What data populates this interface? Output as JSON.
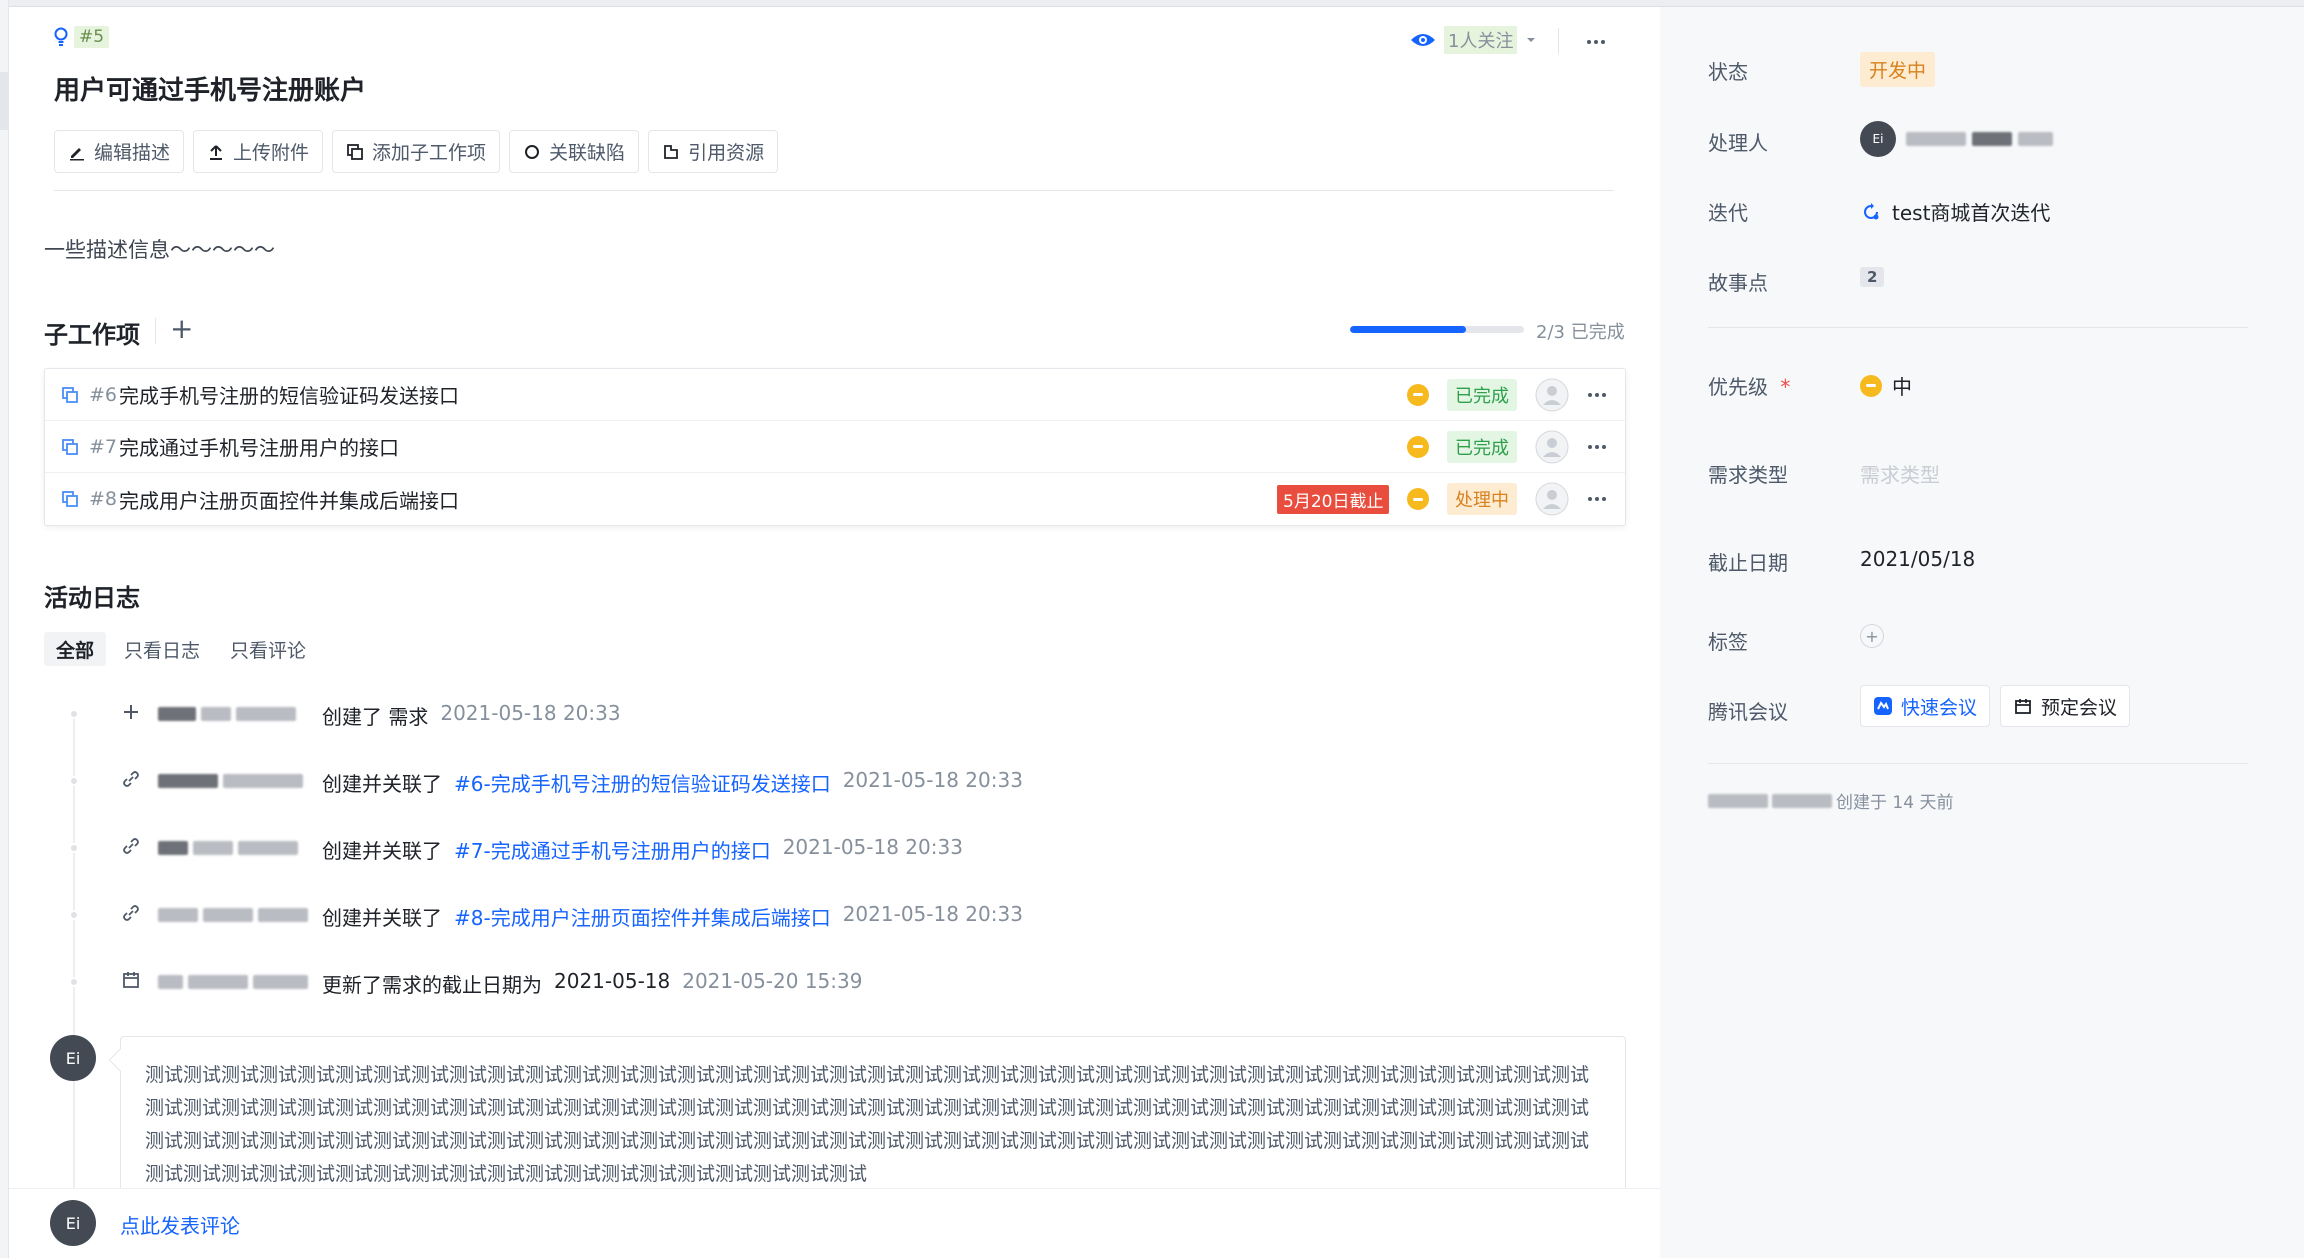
{
  "header": {
    "item_id": "#5",
    "title": "用户可通过手机号注册账户",
    "watch_label": "1人关注"
  },
  "toolbar": {
    "edit_desc": "编辑描述",
    "upload": "上传附件",
    "add_sub": "添加子工作项",
    "link_bug": "关联缺陷",
    "cite_resource": "引用资源"
  },
  "description": "一些描述信息～～～～～",
  "sub_items": {
    "title": "子工作项",
    "progress_text": "2/3 已完成",
    "progress_fraction": 0.6667,
    "rows": [
      {
        "num": "#6",
        "name": "完成手机号注册的短信验证码发送接口",
        "deadline": "",
        "status": "已完成",
        "status_kind": "done"
      },
      {
        "num": "#7",
        "name": "完成通过手机号注册用户的接口",
        "deadline": "",
        "status": "已完成",
        "status_kind": "done"
      },
      {
        "num": "#8",
        "name": "完成用户注册页面控件并集成后端接口",
        "deadline": "5月20日截止",
        "status": "处理中",
        "status_kind": "doing"
      }
    ]
  },
  "activity": {
    "title": "活动日志",
    "tabs": [
      "全部",
      "只看日志",
      "只看评论"
    ],
    "logs": [
      {
        "icon": "plus-icon",
        "action": "创建了 需求",
        "link": "",
        "extra": "",
        "time": "2021-05-18 20:33"
      },
      {
        "icon": "link-icon",
        "action": "创建并关联了",
        "link": "#6-完成手机号注册的短信验证码发送接口",
        "extra": "",
        "time": "2021-05-18 20:33"
      },
      {
        "icon": "link-icon",
        "action": "创建并关联了",
        "link": "#7-完成通过手机号注册用户的接口",
        "extra": "",
        "time": "2021-05-18 20:33"
      },
      {
        "icon": "link-icon",
        "action": "创建并关联了",
        "link": "#8-完成用户注册页面控件并集成后端接口",
        "extra": "",
        "time": "2021-05-18 20:33"
      },
      {
        "icon": "calendar-icon",
        "action": "更新了需求的截止日期为",
        "link": "",
        "extra": "2021-05-18",
        "time": "2021-05-20 15:39"
      }
    ],
    "comment_avatar": "Ei",
    "comment_text": "测试测试测试测试测试测试测试测试测试测试测试测试测试测试测试测试测试测试测试测试测试测试测试测试测试测试测试测试测试测试测试测试测试测试测试测试测试测试测试测试测试测试测试测试测试测试测试测试测试测试测试测试测试测试测试测试测试测试测试测试测试测试测试测试测试测试测试测试测试测试测试测试测试测试测试测试测试测试测试测试测试测试测试测试测试测试测试测试测试测试测试测试测试测试测试测试测试测试测试测试测试测试测试测试测试测试测试测试测试测试测试测试测试测试测试测试测试测试测试测试测试测试测试测试测试测试测试测试测试测试测试测试测试"
  },
  "footer": {
    "avatar": "Ei",
    "comment_prompt": "点此发表评论"
  },
  "side": {
    "status_label": "状态",
    "status_value": "开发中",
    "assignee_label": "处理人",
    "assignee_avatar": "Ei",
    "iteration_label": "迭代",
    "iteration_value": "test商城首次迭代",
    "story_points_label": "故事点",
    "story_points_value": "2",
    "priority_label": "优先级",
    "priority_required": "*",
    "priority_value": "中",
    "req_type_label": "需求类型",
    "req_type_placeholder": "需求类型",
    "due_label": "截止日期",
    "due_value": "2021/05/18",
    "tags_label": "标签",
    "meeting_label": "腾讯会议",
    "quick_meeting": "快速会议",
    "schedule_meeting": "预定会议",
    "created_text": "创建于 14 天前"
  },
  "colors": {
    "accent": "#1664ff",
    "done_green": "#2e9f4a",
    "doing_orange": "#d8821d",
    "deadline_red": "#e84d3d",
    "priority_yellow": "#f7ba1e"
  }
}
